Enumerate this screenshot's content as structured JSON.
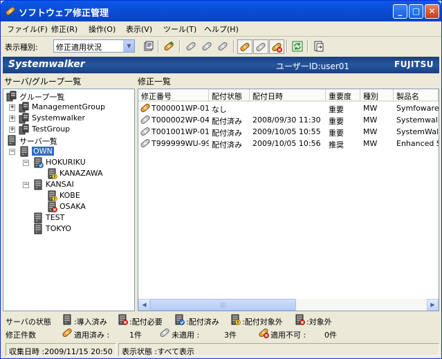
{
  "window": {
    "title": "ソフトウェア修正管理"
  },
  "menu": [
    "ファイル(F)",
    "修正(R)",
    "操作(O)",
    "表示(V)",
    "ツール(T)",
    "ヘルプ(H)"
  ],
  "toolbar": {
    "view_label": "表示種別:",
    "view_value": "修正適用状況"
  },
  "banner": {
    "logo": "Systemwalker",
    "user": "ユーザーID:user01",
    "vendor": "FUJITSU"
  },
  "left_title": "サーバ/グループ一覧",
  "right_title": "修正一覧",
  "tree": {
    "groups_root": "グループ一覧",
    "groups": [
      "ManagementGroup",
      "Systemwalker",
      "TestGroup"
    ],
    "servers_root": "サーバ一覧",
    "own": "OWN",
    "hokuriku": "HOKURIKU",
    "kanazawa": "KANAZAWA",
    "kansai": "KANSAI",
    "kobe": "KOBE",
    "osaka": "OSAKA",
    "test": "TEST",
    "tokyo": "TOKYO"
  },
  "table": {
    "columns": [
      "修正番号",
      "配付状態",
      "配付日時",
      "重要度",
      "種別",
      "製品名"
    ],
    "rows": [
      {
        "icon": "applied",
        "cells": [
          "T000001WP-01",
          "なし",
          "",
          "重要",
          "MW",
          "Symfoware"
        ]
      },
      {
        "icon": "unapplied",
        "cells": [
          "T000002WP-04",
          "配付済み",
          "2008/09/30 11:30",
          "重要",
          "MW",
          "Systemwalk"
        ]
      },
      {
        "icon": "unapplied",
        "cells": [
          "T001001WP-01",
          "配付済み",
          "2009/10/05 10:55",
          "重要",
          "MW",
          "SystemWalk"
        ]
      },
      {
        "icon": "unapplied",
        "cells": [
          "T999999WU-99",
          "配付済み",
          "2009/10/05 10:56",
          "推奨",
          "MW",
          "Enhanced S"
        ]
      }
    ]
  },
  "legend": {
    "title": "サーバの状態",
    "installed": ":導入済み",
    "needed": ":配付必要",
    "distributed": ":配付済み",
    "excluded": ":配付対象外",
    "target": ":対象外"
  },
  "count": {
    "title": "修正件数",
    "applied_label": "適用済み :",
    "applied_count": "1件",
    "unapplied_label": "未適用  :",
    "unapplied_count": "3件",
    "cannot_label": "適用不可 :",
    "cannot_count": "0件"
  },
  "status": {
    "collected": "収集日時 :2009/11/15 20:50",
    "view": "表示状態 :すべて表示"
  },
  "colors": {
    "title_bar": "#0a4fd8",
    "banner": "#1f4a8f",
    "selection": "#316ac5"
  }
}
